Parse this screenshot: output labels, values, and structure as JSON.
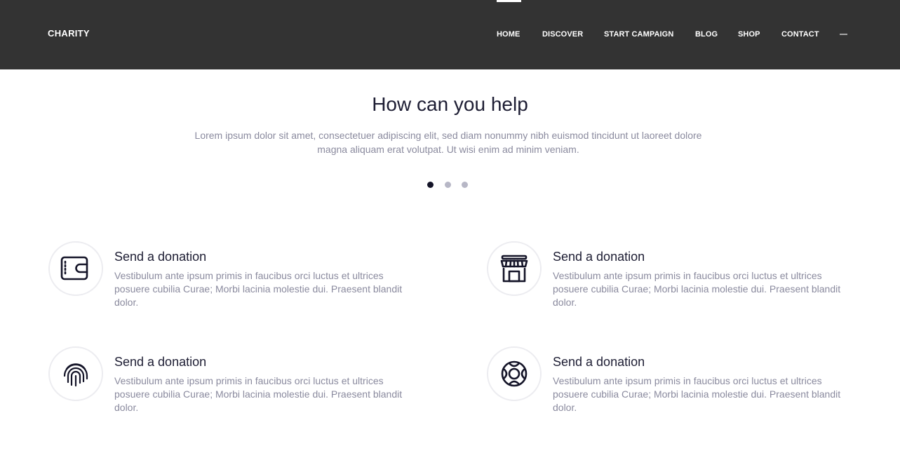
{
  "header": {
    "logo": "CHARITY",
    "nav": [
      "HOME",
      "DISCOVER",
      "START CAMPAIGN",
      "BLOG",
      "SHOP",
      "CONTACT",
      "—"
    ],
    "active_index": 0
  },
  "hero": {
    "title": "How can you help",
    "text": "Lorem ipsum dolor sit amet, consectetuer adipiscing elit, sed diam nonummy nibh euismod tincidunt ut laoreet dolore magna aliquam erat volutpat. Ut wisi enim ad minim veniam.",
    "slides": 3,
    "active_slide": 1
  },
  "features": [
    {
      "icon": "wallet-icon",
      "title": "Send a donation",
      "text": "Vestibulum ante ipsum primis in faucibus orci luctus et ultrices posuere cubilia Curae; Morbi lacinia molestie dui. Praesent blandit dolor."
    },
    {
      "icon": "store-icon",
      "title": "Send a donation",
      "text": "Vestibulum ante ipsum primis in faucibus orci luctus et ultrices posuere cubilia Curae; Morbi lacinia molestie dui. Praesent blandit dolor."
    },
    {
      "icon": "fingerprint-icon",
      "title": "Send a donation",
      "text": "Vestibulum ante ipsum primis in faucibus orci luctus et ultrices posuere cubilia Curae; Morbi lacinia molestie dui. Praesent blandit dolor."
    },
    {
      "icon": "lifebuoy-icon",
      "title": "Send a donation",
      "text": "Vestibulum ante ipsum primis in faucibus orci luctus et ultrices posuere cubilia Curae; Morbi lacinia molestie dui. Praesent blandit dolor."
    }
  ],
  "colors": {
    "header_bg": "#333333",
    "heading": "#1d1d33",
    "body_text": "#8a8a9e",
    "dot_active": "#141428",
    "dot_inactive": "#b7b7c6"
  }
}
